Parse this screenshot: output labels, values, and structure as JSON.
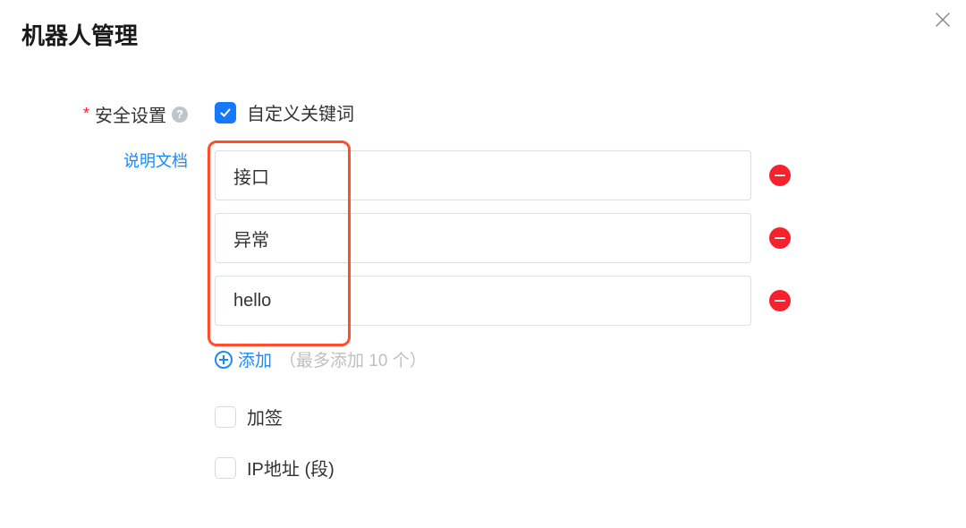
{
  "header": {
    "title": "机器人管理"
  },
  "security": {
    "required_mark": "*",
    "label": "安全设置",
    "help_glyph": "?",
    "doc_link": "说明文档",
    "custom_keyword": {
      "checked": true,
      "label": "自定义关键词",
      "keywords": [
        "接口",
        "异常",
        "hello"
      ],
      "add_label": "添加",
      "add_hint": "（最多添加 10 个）"
    },
    "sign": {
      "checked": false,
      "label": "加签"
    },
    "ip": {
      "checked": false,
      "label": "IP地址 (段)"
    }
  }
}
